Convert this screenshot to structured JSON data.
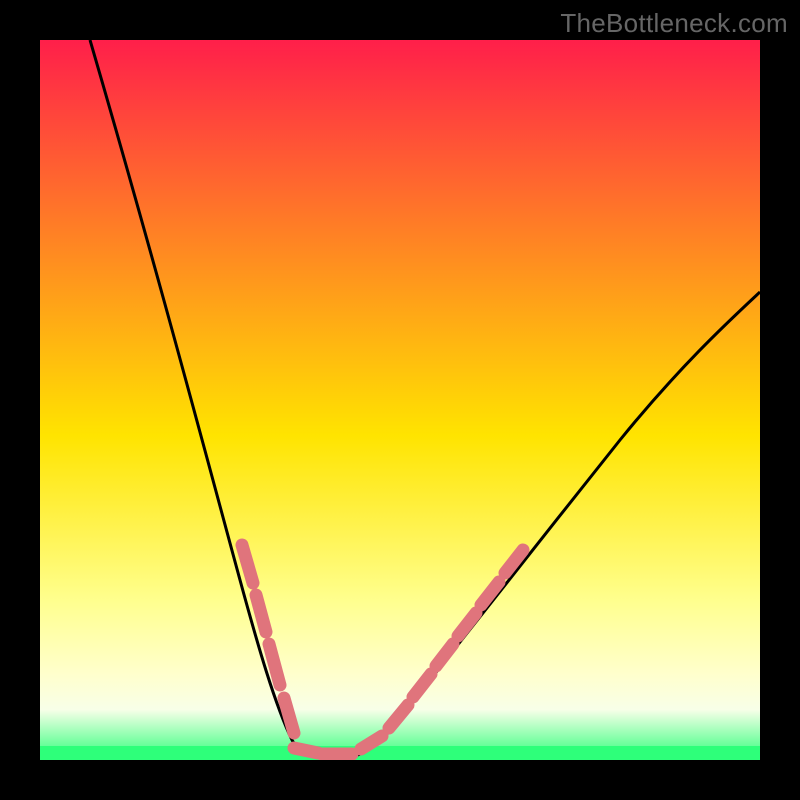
{
  "watermark": "TheBottleneck.com",
  "colors": {
    "frame": "#000000",
    "grad_top": "#ff1f4a",
    "grad_mid1": "#ff7a27",
    "grad_mid2": "#ffe400",
    "grad_low": "#ffff8f",
    "grad_paleyellow": "#ffffcc",
    "grad_band": "#f8ffe8",
    "grad_bottom": "#2eff7a",
    "curve": "#000000",
    "overlay": "#e0747c"
  },
  "chart_data": {
    "type": "line",
    "title": "",
    "xlabel": "",
    "ylabel": "",
    "xlim": [
      0,
      100
    ],
    "ylim": [
      0,
      100
    ],
    "series": [
      {
        "name": "bottleneck-curve",
        "x": [
          7,
          10,
          13,
          16,
          19,
          22,
          25,
          27,
          29,
          31,
          32.5,
          34,
          35.5,
          37,
          40,
          45,
          50,
          55,
          60,
          65,
          70,
          75,
          80,
          85,
          90,
          95,
          100
        ],
        "y": [
          100,
          90,
          80,
          70,
          60,
          50,
          40,
          33,
          26,
          18,
          11,
          6,
          3,
          1,
          0,
          2,
          5,
          9,
          14,
          19,
          25,
          31,
          37,
          44,
          51,
          58,
          65
        ]
      }
    ],
    "overlay_segments": {
      "name": "pink-dashes",
      "left_branch_y_range": [
        4,
        30
      ],
      "right_branch_y_range": [
        3,
        30
      ],
      "bottom_flat_x_range": [
        33,
        43
      ]
    }
  }
}
